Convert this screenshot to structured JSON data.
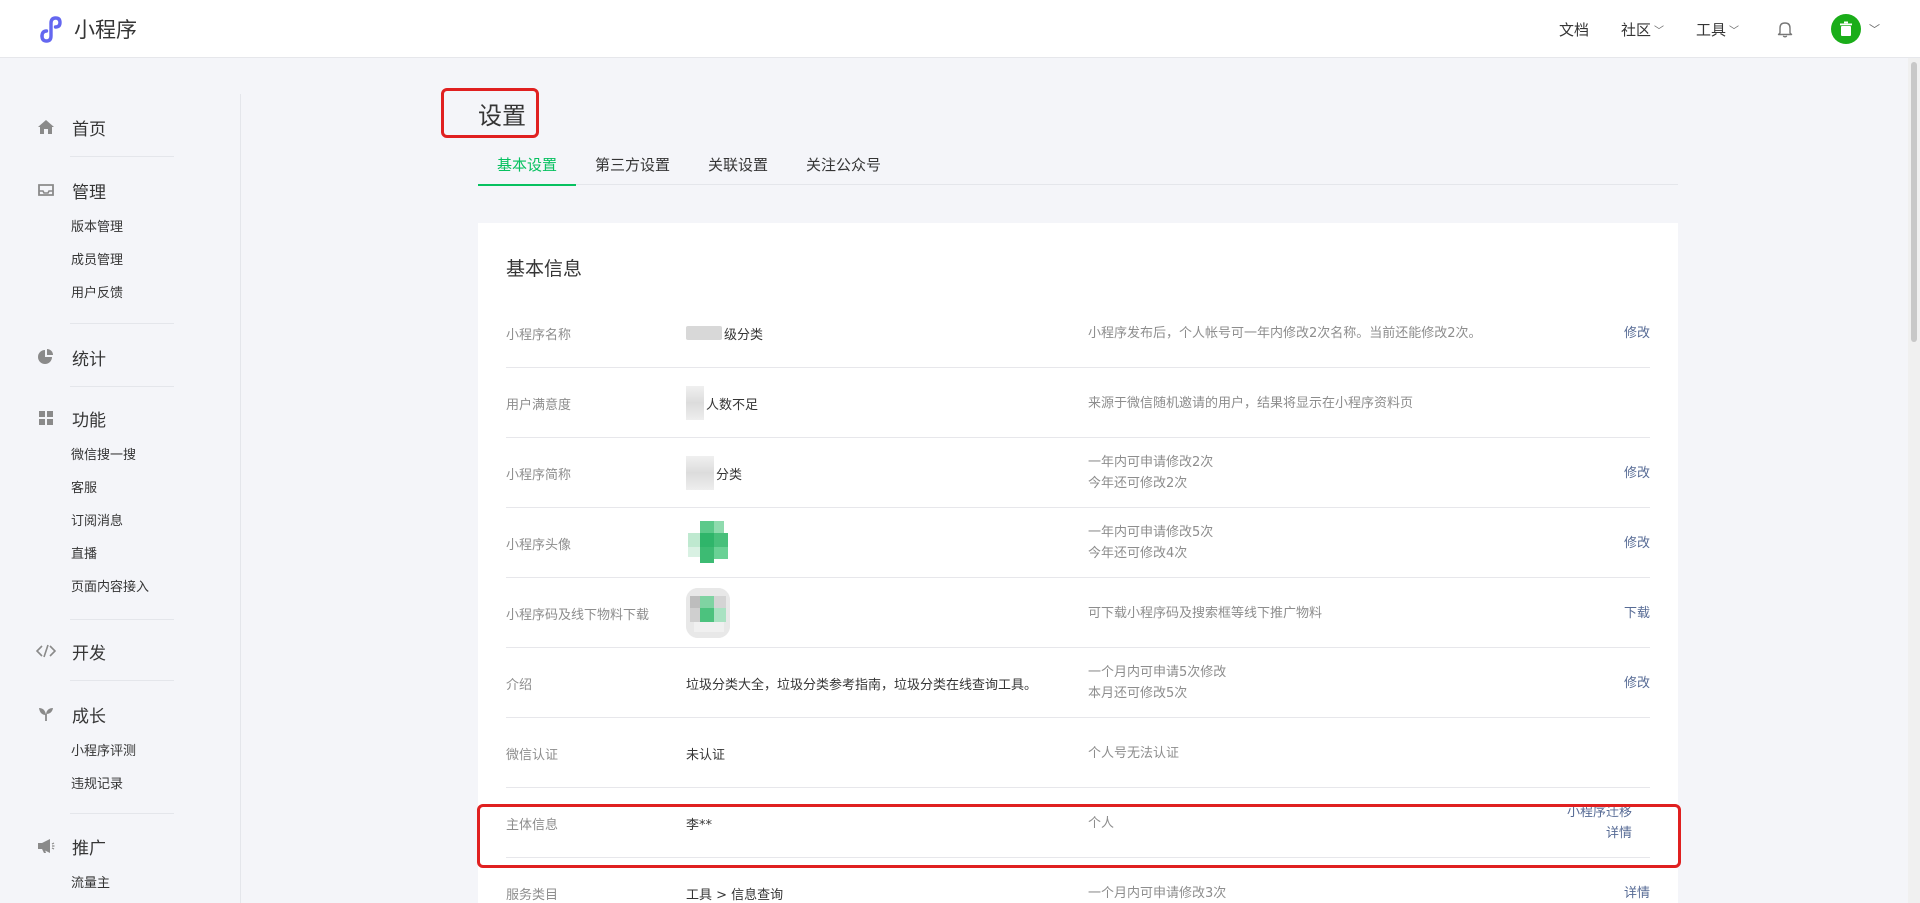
{
  "header": {
    "app_name": "小程序",
    "nav": [
      {
        "label": "文档",
        "has_dropdown": false
      },
      {
        "label": "社区",
        "has_dropdown": true
      },
      {
        "label": "工具",
        "has_dropdown": true
      }
    ],
    "icons": [
      "bell-icon",
      "avatar"
    ],
    "colors": {
      "brand": "#6467f0",
      "avatar_bg": "#1aad19"
    }
  },
  "sidebar": {
    "groups": [
      {
        "label": "首页",
        "icon": "home-icon",
        "items": []
      },
      {
        "label": "管理",
        "icon": "inbox-icon",
        "items": [
          "版本管理",
          "成员管理",
          "用户反馈"
        ]
      },
      {
        "label": "统计",
        "icon": "pie-chart-icon",
        "items": []
      },
      {
        "label": "功能",
        "icon": "grid-icon",
        "items": [
          "微信搜一搜",
          "客服",
          "订阅消息",
          "直播",
          "页面内容接入"
        ]
      },
      {
        "label": "开发",
        "icon": "code-icon",
        "items": []
      },
      {
        "label": "成长",
        "icon": "sprout-icon",
        "items": [
          "小程序评测",
          "违规记录"
        ]
      },
      {
        "label": "推广",
        "icon": "megaphone-icon",
        "items": [
          "流量主"
        ]
      }
    ]
  },
  "main": {
    "page_title": "设置",
    "tabs": [
      {
        "label": "基本设置",
        "active": true
      },
      {
        "label": "第三方设置",
        "active": false
      },
      {
        "label": "关联设置",
        "active": false
      },
      {
        "label": "关注公众号",
        "active": false
      }
    ],
    "section_title": "基本信息",
    "rows": [
      {
        "label": "小程序名称",
        "value": "级分类",
        "notes": [
          "小程序发布后，个人帐号可一年内修改2次名称。当前还能修改2次。"
        ],
        "actions": [
          "修改"
        ]
      },
      {
        "label": "用户满意度",
        "value": "人数不足",
        "notes": [
          "来源于微信随机邀请的用户，结果将显示在小程序资料页"
        ],
        "actions": []
      },
      {
        "label": "小程序简称",
        "value": "分类",
        "notes": [
          "一年内可申请修改2次",
          "今年还可修改2次"
        ],
        "actions": [
          "修改"
        ]
      },
      {
        "label": "小程序头像",
        "value": "",
        "notes": [
          "一年内可申请修改5次",
          "今年还可修改4次"
        ],
        "actions": [
          "修改"
        ]
      },
      {
        "label": "小程序码及线下物料下载",
        "value": "",
        "notes": [
          "可下载小程序码及搜索框等线下推广物料"
        ],
        "actions": [
          "下载"
        ]
      },
      {
        "label": "介绍",
        "value": "垃圾分类大全，垃圾分类参考指南，垃圾分类在线查询工具。",
        "notes": [
          "一个月内可申请5次修改",
          "本月还可修改5次"
        ],
        "actions": [
          "修改"
        ]
      },
      {
        "label": "微信认证",
        "value": "未认证",
        "notes": [
          "个人号无法认证"
        ],
        "actions": []
      },
      {
        "label": "主体信息",
        "value": "李**",
        "notes": [
          "个人"
        ],
        "actions": [
          "小程序迁移",
          "详情"
        ]
      },
      {
        "label": "服务类目",
        "value": "工具 > 信息查询",
        "notes": [
          "一个月内可申请修改3次"
        ],
        "actions": [
          "详情"
        ]
      }
    ],
    "colors": {
      "accent": "#07c160",
      "link": "#576b95",
      "highlight": "#e02020"
    }
  }
}
